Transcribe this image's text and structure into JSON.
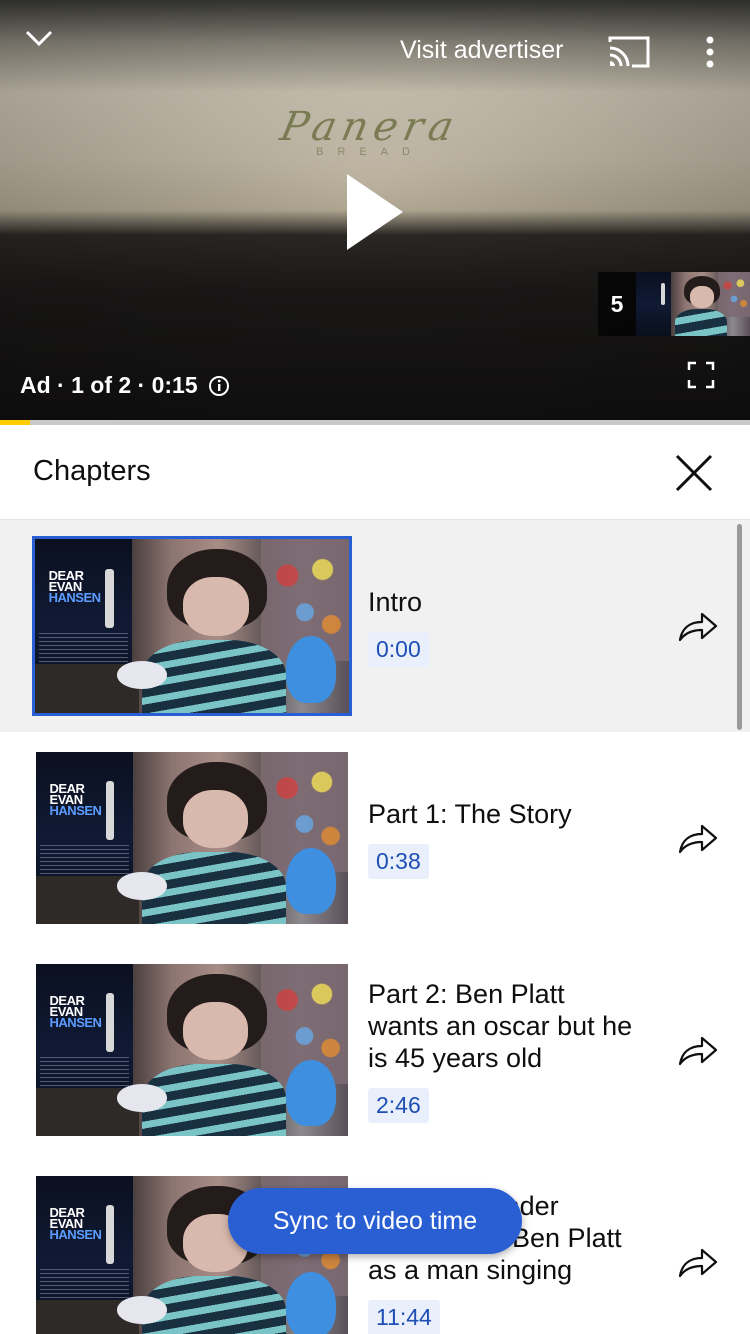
{
  "player": {
    "visit_advertiser": "Visit advertiser",
    "ad_info": "Ad · 1 of 2 · 0:15",
    "ad_progress": 0.04,
    "next_count": "5",
    "ad_brand": "Panera",
    "ad_brand_sub": "BREAD",
    "icons": {
      "collapse": "chevron-down-icon",
      "cast": "cast-icon",
      "more": "more-vert-icon",
      "play": "play-icon",
      "info": "info-icon",
      "fullscreen": "fullscreen-icon"
    },
    "accent": "#ffcc00"
  },
  "chapters": {
    "title": "Chapters",
    "close_icon": "close-icon",
    "sync_label": "Sync to video time",
    "accent": "#2a5fd4",
    "thumb_text": {
      "line1": "DEAR",
      "line2": "EVAN",
      "line3": "HANSEN"
    },
    "items": [
      {
        "title": "Intro",
        "time": "0:00",
        "active": true
      },
      {
        "title": "Part 1: The Story",
        "time": "0:38",
        "active": false
      },
      {
        "title": "Part 2: Ben Platt wants an oscar but he is 45 years old",
        "time": "2:46",
        "active": false
      },
      {
        "title": "Part 3: I wonder tommy why Ben Platt as a man singing",
        "time": "11:44",
        "active": false
      }
    ]
  }
}
